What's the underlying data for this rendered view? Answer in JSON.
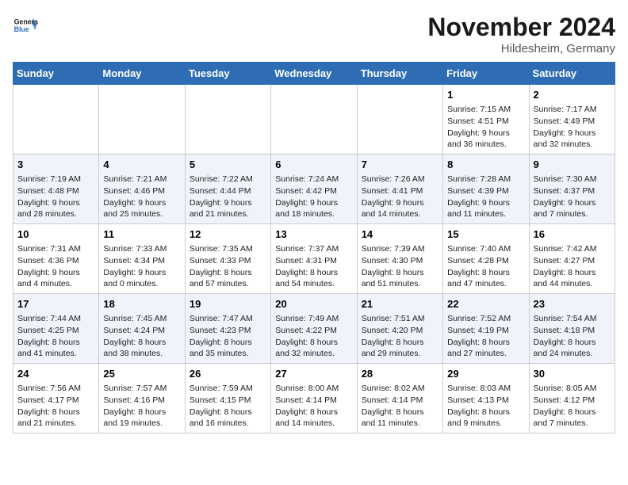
{
  "header": {
    "logo_general": "General",
    "logo_blue": "Blue",
    "month_title": "November 2024",
    "location": "Hildesheim, Germany"
  },
  "weekdays": [
    "Sunday",
    "Monday",
    "Tuesday",
    "Wednesday",
    "Thursday",
    "Friday",
    "Saturday"
  ],
  "weeks": [
    [
      {
        "day": "",
        "info": ""
      },
      {
        "day": "",
        "info": ""
      },
      {
        "day": "",
        "info": ""
      },
      {
        "day": "",
        "info": ""
      },
      {
        "day": "",
        "info": ""
      },
      {
        "day": "1",
        "info": "Sunrise: 7:15 AM\nSunset: 4:51 PM\nDaylight: 9 hours and 36 minutes."
      },
      {
        "day": "2",
        "info": "Sunrise: 7:17 AM\nSunset: 4:49 PM\nDaylight: 9 hours and 32 minutes."
      }
    ],
    [
      {
        "day": "3",
        "info": "Sunrise: 7:19 AM\nSunset: 4:48 PM\nDaylight: 9 hours and 28 minutes."
      },
      {
        "day": "4",
        "info": "Sunrise: 7:21 AM\nSunset: 4:46 PM\nDaylight: 9 hours and 25 minutes."
      },
      {
        "day": "5",
        "info": "Sunrise: 7:22 AM\nSunset: 4:44 PM\nDaylight: 9 hours and 21 minutes."
      },
      {
        "day": "6",
        "info": "Sunrise: 7:24 AM\nSunset: 4:42 PM\nDaylight: 9 hours and 18 minutes."
      },
      {
        "day": "7",
        "info": "Sunrise: 7:26 AM\nSunset: 4:41 PM\nDaylight: 9 hours and 14 minutes."
      },
      {
        "day": "8",
        "info": "Sunrise: 7:28 AM\nSunset: 4:39 PM\nDaylight: 9 hours and 11 minutes."
      },
      {
        "day": "9",
        "info": "Sunrise: 7:30 AM\nSunset: 4:37 PM\nDaylight: 9 hours and 7 minutes."
      }
    ],
    [
      {
        "day": "10",
        "info": "Sunrise: 7:31 AM\nSunset: 4:36 PM\nDaylight: 9 hours and 4 minutes."
      },
      {
        "day": "11",
        "info": "Sunrise: 7:33 AM\nSunset: 4:34 PM\nDaylight: 9 hours and 0 minutes."
      },
      {
        "day": "12",
        "info": "Sunrise: 7:35 AM\nSunset: 4:33 PM\nDaylight: 8 hours and 57 minutes."
      },
      {
        "day": "13",
        "info": "Sunrise: 7:37 AM\nSunset: 4:31 PM\nDaylight: 8 hours and 54 minutes."
      },
      {
        "day": "14",
        "info": "Sunrise: 7:39 AM\nSunset: 4:30 PM\nDaylight: 8 hours and 51 minutes."
      },
      {
        "day": "15",
        "info": "Sunrise: 7:40 AM\nSunset: 4:28 PM\nDaylight: 8 hours and 47 minutes."
      },
      {
        "day": "16",
        "info": "Sunrise: 7:42 AM\nSunset: 4:27 PM\nDaylight: 8 hours and 44 minutes."
      }
    ],
    [
      {
        "day": "17",
        "info": "Sunrise: 7:44 AM\nSunset: 4:25 PM\nDaylight: 8 hours and 41 minutes."
      },
      {
        "day": "18",
        "info": "Sunrise: 7:45 AM\nSunset: 4:24 PM\nDaylight: 8 hours and 38 minutes."
      },
      {
        "day": "19",
        "info": "Sunrise: 7:47 AM\nSunset: 4:23 PM\nDaylight: 8 hours and 35 minutes."
      },
      {
        "day": "20",
        "info": "Sunrise: 7:49 AM\nSunset: 4:22 PM\nDaylight: 8 hours and 32 minutes."
      },
      {
        "day": "21",
        "info": "Sunrise: 7:51 AM\nSunset: 4:20 PM\nDaylight: 8 hours and 29 minutes."
      },
      {
        "day": "22",
        "info": "Sunrise: 7:52 AM\nSunset: 4:19 PM\nDaylight: 8 hours and 27 minutes."
      },
      {
        "day": "23",
        "info": "Sunrise: 7:54 AM\nSunset: 4:18 PM\nDaylight: 8 hours and 24 minutes."
      }
    ],
    [
      {
        "day": "24",
        "info": "Sunrise: 7:56 AM\nSunset: 4:17 PM\nDaylight: 8 hours and 21 minutes."
      },
      {
        "day": "25",
        "info": "Sunrise: 7:57 AM\nSunset: 4:16 PM\nDaylight: 8 hours and 19 minutes."
      },
      {
        "day": "26",
        "info": "Sunrise: 7:59 AM\nSunset: 4:15 PM\nDaylight: 8 hours and 16 minutes."
      },
      {
        "day": "27",
        "info": "Sunrise: 8:00 AM\nSunset: 4:14 PM\nDaylight: 8 hours and 14 minutes."
      },
      {
        "day": "28",
        "info": "Sunrise: 8:02 AM\nSunset: 4:14 PM\nDaylight: 8 hours and 11 minutes."
      },
      {
        "day": "29",
        "info": "Sunrise: 8:03 AM\nSunset: 4:13 PM\nDaylight: 8 hours and 9 minutes."
      },
      {
        "day": "30",
        "info": "Sunrise: 8:05 AM\nSunset: 4:12 PM\nDaylight: 8 hours and 7 minutes."
      }
    ]
  ]
}
